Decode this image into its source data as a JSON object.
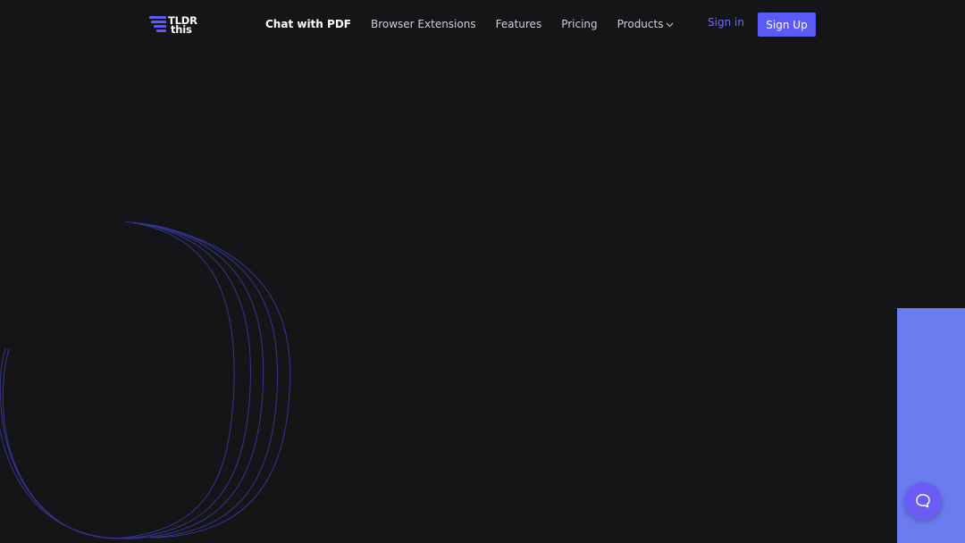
{
  "brand": {
    "name_line1": "TLDR",
    "name_line2": "this",
    "logo_icon": "stacked-lines-logo-icon",
    "color": "#5b5bf7"
  },
  "nav": {
    "items": [
      {
        "label": "Chat with PDF",
        "active": true
      },
      {
        "label": "Browser Extensions",
        "active": false
      },
      {
        "label": "Features",
        "active": false
      },
      {
        "label": "Pricing",
        "active": false
      },
      {
        "label": "Products",
        "active": false,
        "has_dropdown": true,
        "icon": "chevron-down-icon"
      }
    ]
  },
  "auth": {
    "signin_label": "Sign in",
    "signup_label": "Sign Up"
  },
  "colors": {
    "background": "#151518",
    "accent": "#5b5bf7",
    "signin_text": "#6f6cff",
    "side_panel": "#6b7cf0",
    "curve_stroke": "#3b3ba8"
  },
  "widgets": {
    "chat_icon": "chat-bubble-icon"
  }
}
